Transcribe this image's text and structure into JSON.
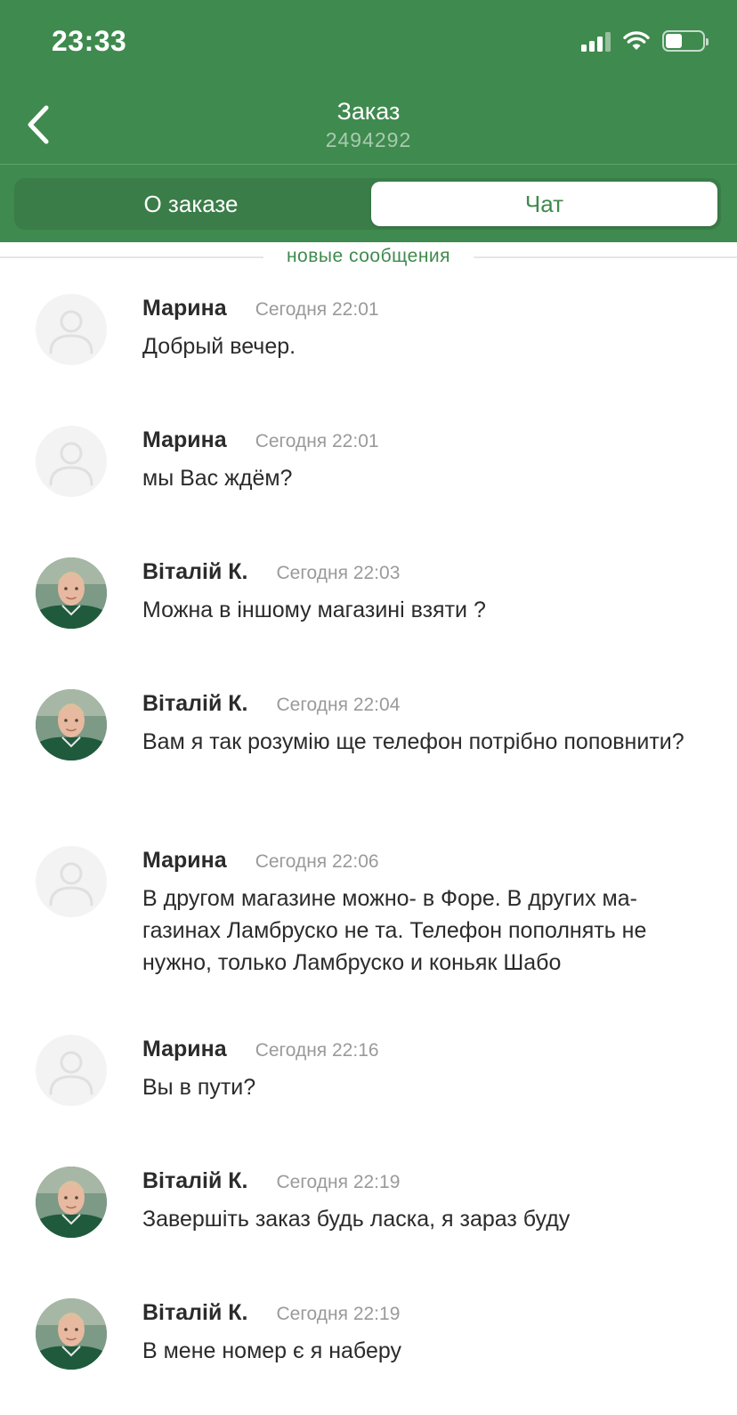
{
  "status_bar": {
    "time": "23:33",
    "battery_level": 0.45
  },
  "header": {
    "title": "Заказ",
    "order_number": "2494292",
    "background_color": "#3f8a4e"
  },
  "tabs": [
    {
      "label": "О заказе",
      "active": false
    },
    {
      "label": "Чат",
      "active": true
    }
  ],
  "divider_label": "новые сообщения",
  "messages": [
    {
      "author": "Марина",
      "time": "Сегодня 22:01",
      "text": "Добрый вечер.",
      "avatar": "placeholder"
    },
    {
      "author": "Марина",
      "time": "Сегодня 22:01",
      "text": "мы Вас ждём?",
      "avatar": "placeholder"
    },
    {
      "author": "Віталій К.",
      "time": "Сегодня 22:03",
      "text": "Можна в іншому магазині взяти ?",
      "avatar": "photo"
    },
    {
      "author": "Віталій К.",
      "time": "Сегодня 22:04",
      "text": "Вам я так розумію ще телефон потрібно поповнити?",
      "avatar": "photo"
    },
    {
      "author": "Марина",
      "time": "Сегодня 22:06",
      "text": "В другом магазине можно- в Форе. В других ма-газинах Ламбруско не та. Телефон пополнять не нужно, только Ламбруско и коньяк Шабо",
      "avatar": "placeholder"
    },
    {
      "author": "Марина",
      "time": "Сегодня 22:16",
      "text": "Вы в пути?",
      "avatar": "placeholder"
    },
    {
      "author": "Віталій К.",
      "time": "Сегодня 22:19",
      "text": "Завершіть заказ будь ласка, я зараз буду",
      "avatar": "photo"
    },
    {
      "author": "Віталій К.",
      "time": "Сегодня 22:19",
      "text": "В мене номер є я наберу",
      "avatar": "photo"
    }
  ]
}
